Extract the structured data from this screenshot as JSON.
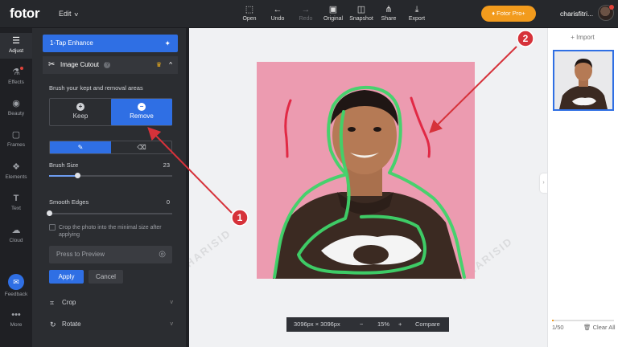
{
  "app": {
    "logo": "fotor",
    "edit_menu": "Edit",
    "username": "charisfitri...",
    "pro_button": "Fotor Pro+"
  },
  "toolbar": {
    "items": [
      {
        "label": "Open",
        "icon": "open-image-icon"
      },
      {
        "label": "Undo",
        "icon": "undo-arrow-icon"
      },
      {
        "label": "Redo",
        "icon": "redo-arrow-icon"
      },
      {
        "label": "Original",
        "icon": "original-image-icon"
      },
      {
        "label": "Snapshot",
        "icon": "snapshot-icon"
      },
      {
        "label": "Share",
        "icon": "share-icon"
      },
      {
        "label": "Export",
        "icon": "export-download-icon"
      }
    ]
  },
  "rail": {
    "items": [
      {
        "label": "Adjust",
        "icon": "sliders-icon"
      },
      {
        "label": "Effects",
        "icon": "flask-icon"
      },
      {
        "label": "Beauty",
        "icon": "eye-icon"
      },
      {
        "label": "Frames",
        "icon": "frame-icon"
      },
      {
        "label": "Elements",
        "icon": "elements-icon"
      },
      {
        "label": "Text",
        "icon": "text-t-icon"
      },
      {
        "label": "Cloud",
        "icon": "cloud-icon"
      },
      {
        "label": "Feedback",
        "icon": "chat-bubble-icon"
      },
      {
        "label": "More",
        "icon": "more-dots-icon"
      }
    ]
  },
  "panel": {
    "one_tap": "1-Tap Enhance",
    "cutout_title": "Image Cutout",
    "instruction": "Brush your kept and removal areas",
    "keep_label": "Keep",
    "remove_label": "Remove",
    "brush_size_label": "Brush Size",
    "brush_size_value": "23",
    "brush_size_level": 0.23,
    "smooth_edges_label": "Smooth Edges",
    "smooth_edges_value": "0",
    "smooth_edges_level": 0,
    "crop_checkbox_text": "Crop the photo into the minimal size after applying",
    "preview_label": "Press to Preview",
    "apply_label": "Apply",
    "cancel_label": "Cancel",
    "crop_section": "Crop",
    "rotate_section": "Rotate"
  },
  "canvas": {
    "watermark": "CHARISID",
    "dimensions": "3096px × 3096px",
    "zoom": "15%",
    "zoom_out": "−",
    "zoom_in": "+",
    "compare": "Compare"
  },
  "right_panel": {
    "import_label": "+ Import",
    "count": "1/50",
    "clear_all": "Clear All",
    "count_level": 0.02
  },
  "annotations": {
    "marker_1": "1",
    "marker_2": "2",
    "color": "#d6323a"
  },
  "colors": {
    "accent": "#2f6fe4",
    "pro": "#f29b1d",
    "photo_bg": "#ec9bb0",
    "brush_keep": "#3fd46a",
    "brush_remove": "#e0233f"
  }
}
